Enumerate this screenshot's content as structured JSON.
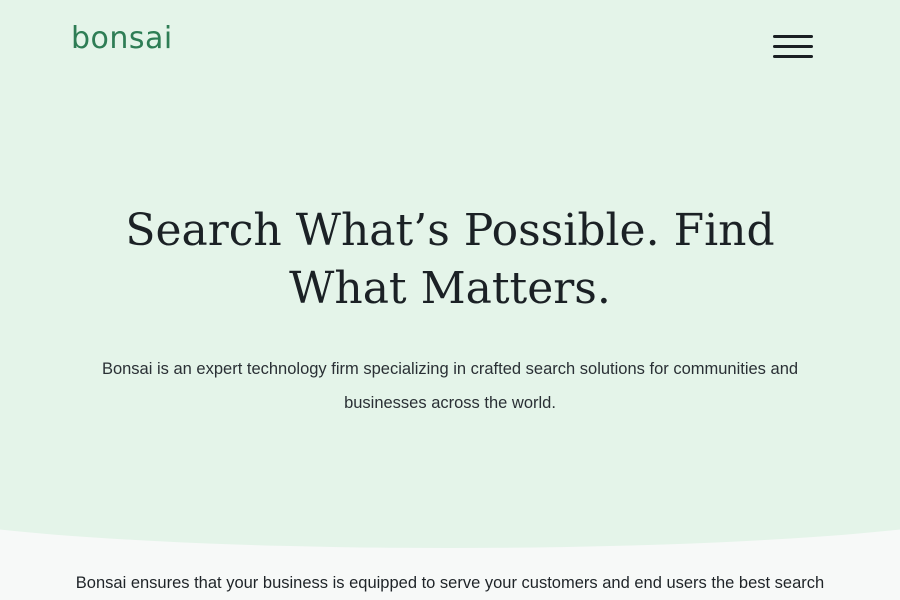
{
  "header": {
    "logo_text": "bonsai",
    "menu_icon": "hamburger-menu-icon"
  },
  "hero": {
    "headline": "Search What’s Possible. Find What Matters.",
    "subtext": "Bonsai is an expert technology firm specializing in crafted search solutions for communities and businesses across the world."
  },
  "section": {
    "intro_text": "Bonsai ensures that your business is equipped to serve your customers and end users the best search"
  },
  "colors": {
    "brand_green": "#2e7d55",
    "hero_background": "#e4f4e9",
    "page_background": "#f7f9f8",
    "text_dark": "#1b2125"
  }
}
